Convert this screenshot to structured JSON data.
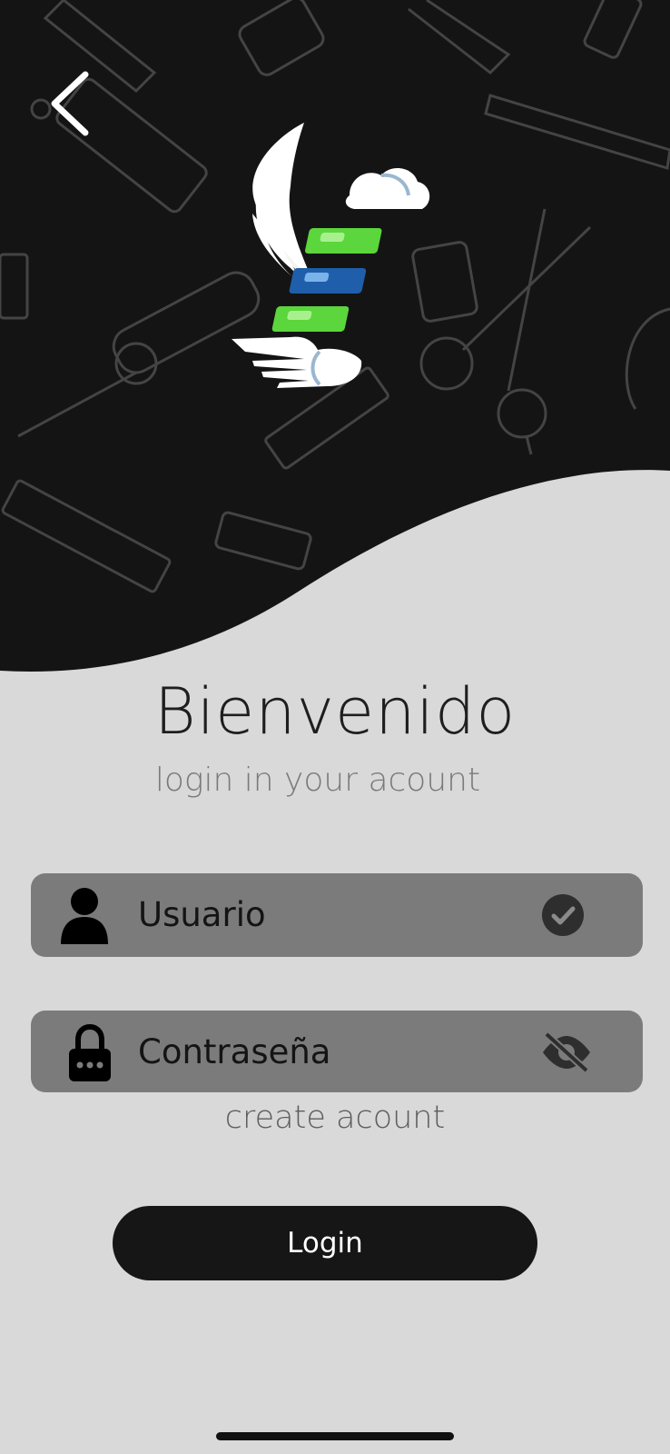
{
  "header": {
    "back_icon": "chevron-left-icon",
    "background_pattern": "barber-tools-pattern",
    "logo_icon": "barber-wings-logo"
  },
  "welcome": {
    "title": "Bienvenido",
    "subtitle": "login in your acount"
  },
  "form": {
    "username": {
      "label": "Usuario",
      "leading_icon": "user-icon",
      "trailing_icon": "check-circle-icon"
    },
    "password": {
      "label": "Contraseña",
      "leading_icon": "lock-icon",
      "trailing_icon": "eye-off-icon"
    },
    "create_account_label": "create acount",
    "login_label": "Login"
  },
  "colors": {
    "hero_bg": "#141414",
    "page_bg": "#d9d9d9",
    "field_bg": "#7b7b7b",
    "button_bg": "#161616",
    "logo_green": "#5bd63c",
    "logo_blue": "#1f5eaa"
  }
}
